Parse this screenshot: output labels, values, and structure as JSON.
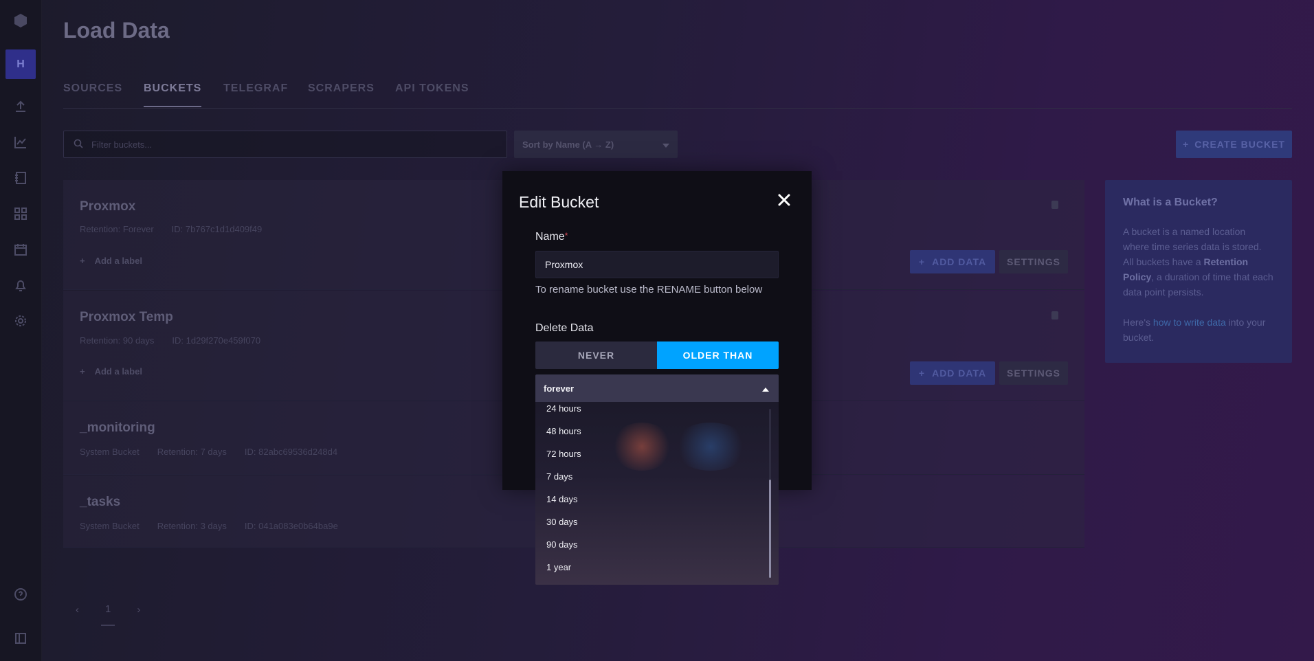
{
  "page": {
    "title": "Load Data"
  },
  "sidebar": {
    "avatar_initial": "H"
  },
  "tabs": [
    "SOURCES",
    "BUCKETS",
    "TELEGRAF",
    "SCRAPERS",
    "API TOKENS"
  ],
  "toolbar": {
    "filter_placeholder": "Filter buckets...",
    "sort_label": "Sort by Name (A → Z)",
    "create_label": "CREATE BUCKET"
  },
  "buckets": [
    {
      "name": "Proxmox",
      "retention": "Retention: Forever",
      "id": "ID: 7b767c1d1d409f49",
      "add_label": "Add a label",
      "add_data": "ADD DATA",
      "settings": "SETTINGS"
    },
    {
      "name": "Proxmox Temp",
      "retention": "Retention: 90 days",
      "id": "ID: 1d29f270e459f070",
      "add_label": "Add a label",
      "add_data": "ADD DATA",
      "settings": "SETTINGS"
    },
    {
      "name": "_monitoring",
      "type": "System Bucket",
      "retention": "Retention: 7 days",
      "id": "ID: 82abc69536d248d4"
    },
    {
      "name": "_tasks",
      "type": "System Bucket",
      "retention": "Retention: 3 days",
      "id": "ID: 041a083e0b64ba9e"
    }
  ],
  "info": {
    "heading": "What is a Bucket?",
    "p1_a": "A bucket is a named location where time series data is stored. All buckets have a ",
    "p1_bold": "Retention Policy",
    "p1_b": ", a duration of time that each data point persists.",
    "p2_a": "Here's ",
    "p2_link": "how to write data",
    "p2_b": " into your bucket."
  },
  "pagination": {
    "current": "1"
  },
  "modal": {
    "title": "Edit Bucket",
    "name_label": "Name",
    "required_mark": "*",
    "name_value": "Proxmox",
    "help_text": "To rename bucket use the RENAME button below",
    "delete_label": "Delete Data",
    "toggle_never": "NEVER",
    "toggle_older": "OLDER THAN",
    "dropdown_selected": "forever",
    "options": [
      "24 hours",
      "48 hours",
      "72 hours",
      "7 days",
      "14 days",
      "30 days",
      "90 days",
      "1 year"
    ]
  },
  "colors": {
    "accent": "#00a3ff",
    "modal_bg": "#0f0e16",
    "required": "#dc4e58"
  }
}
